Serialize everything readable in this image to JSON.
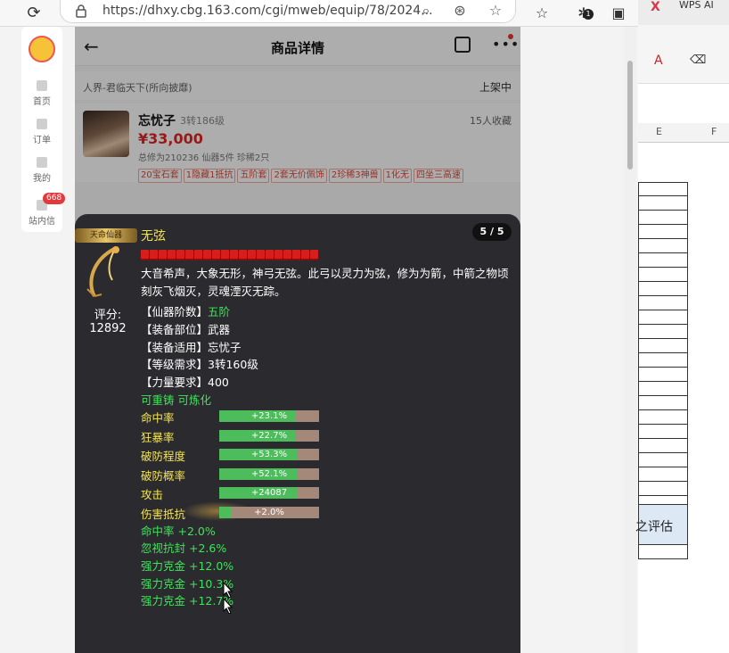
{
  "browser": {
    "url": "https://dhxy.cbg.163.com/cgi/mweb/equip/78/2024...",
    "badge_count": "1",
    "tab_right": "WPS AI"
  },
  "site_nav": {
    "items": [
      {
        "label": "首页"
      },
      {
        "label": "订单"
      },
      {
        "label": "我的"
      },
      {
        "label": "站内信"
      }
    ],
    "message_badge": "668"
  },
  "page": {
    "title": "商品详情",
    "server": "人界-君临天下(所向披靡)",
    "status": "上架中",
    "product": {
      "name": "忘忧子",
      "level": "3转186级",
      "favorites": "15人收藏",
      "price": "¥33,000",
      "meta": "总修为210236  仙器5件  珍稀2只",
      "tags": [
        "20宝石套",
        "1隐藏1抵抗",
        "五阶套",
        "2套无价佩饰",
        "2珍稀3神兽",
        "1化无",
        "四坐三高速"
      ]
    }
  },
  "item": {
    "ribbon": "天命仙器",
    "name": "无弦",
    "pager": "5 / 5",
    "gem_count": 20,
    "score_label": "评分:",
    "score_value": "12892",
    "description": "大音希声，大象无形，神弓无弦。此弓以灵力为弦，修为为箭，中箭之物顷刻灰飞烟灭，灵魂湮灭无踪。",
    "info": [
      {
        "key": "【仙器阶数】",
        "value": "五阶",
        "green": true
      },
      {
        "key": "【装备部位】",
        "value": "武器",
        "green": false
      },
      {
        "key": "【装备适用】",
        "value": "忘忧子",
        "green": false
      },
      {
        "key": "【等级需求】",
        "value": "3转160级",
        "green": false
      },
      {
        "key": "【力量要求】",
        "value": "400",
        "green": false
      }
    ],
    "reforge": "可重铸 可炼化",
    "stats": [
      {
        "label": "命中率",
        "text": "+23.1%",
        "fill": 0.77
      },
      {
        "label": "狂暴率",
        "text": "+22.7%",
        "fill": 0.76
      },
      {
        "label": "破防程度",
        "text": "+53.3%",
        "fill": 0.79
      },
      {
        "label": "破防概率",
        "text": "+52.1%",
        "fill": 0.78
      },
      {
        "label": "攻击",
        "text": "+24087",
        "fill": 0.79
      },
      {
        "label": "伤害抵抗",
        "text": "+2.0%",
        "fill": 0.12
      }
    ],
    "extras": [
      "命中率 +2.0%",
      "忽视抗封 +2.6%",
      "强力克金 +12.0%",
      "强力克金 +10.3%",
      "强力克金 +12.7%"
    ]
  },
  "sheet": {
    "col_e": "E",
    "col_f": "F",
    "cell_text": "之评估"
  }
}
